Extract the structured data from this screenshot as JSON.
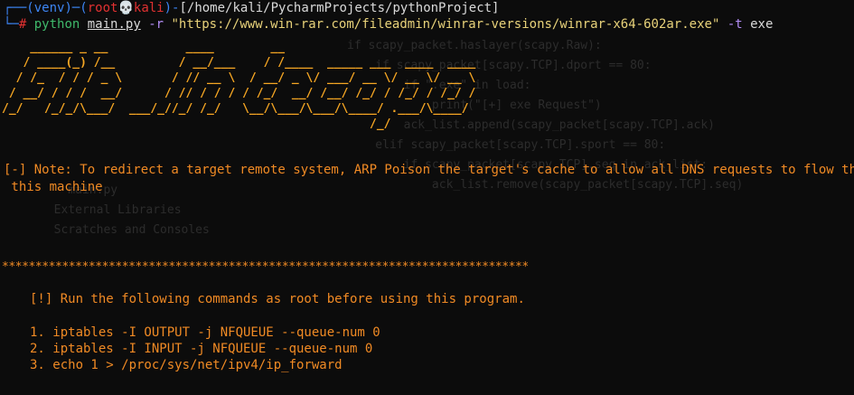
{
  "prompt": {
    "env": "(venv)",
    "user": "root",
    "skull": "💀",
    "host": "kali",
    "path": "[/home/kali/PycharmProjects/pythonProject]",
    "hash": "#",
    "cmd_python": "python",
    "cmd_file": "main.py",
    "flag_r": "-r",
    "url": "\"https://www.win-rar.com/fileadmin/winrar-versions/winrar-x64-602ar.exe\"",
    "flag_t": "-t",
    "type": "exe"
  },
  "banner": {
    "line1": "    ______ _ __           ____        __                      ",
    "line2": "   / ____(_) /__         / __/___    / /____  _____ ___  ____  ____  ",
    "line3": "  / /_  / / / _ \\       / // __ \\  / __/ _ \\/ ___/ __ \\/ __ \\/ __ \\ ",
    "line4": " / __/ / / /  __/      / // / / / / /_/  __/ /__/ /_/ / /_/ / /_/ / ",
    "line5": "/_/   /_/_/\\___/  ___/_//_/ /_/   \\__/\\___/\\___/\\____/ .___/\\____/  ",
    "line6": "                                                    /_/"
  },
  "note": {
    "line1": "[-] Note: To redirect a target remote system, ARP Poison the target's cache to allow all DNS requests to flow through",
    "line2": " this machine"
  },
  "separator": "*******************************************************************************",
  "instructions": {
    "header": "[!] Run the following commands as root before using this program.",
    "steps": [
      "1. iptables -I OUTPUT -j NFQUEUE --queue-num 0",
      "2. iptables -I INPUT -j NFQUEUE --queue-num 0",
      "3. echo 1 > /proc/sys/net/ipv4/ip_forward"
    ]
  },
  "colors": {
    "background": "#0c0c0c",
    "prompt_blue": "#3d86f5",
    "prompt_red": "#e23131",
    "banner_orange": "#f5a623",
    "text_orange": "#f08a24"
  }
}
